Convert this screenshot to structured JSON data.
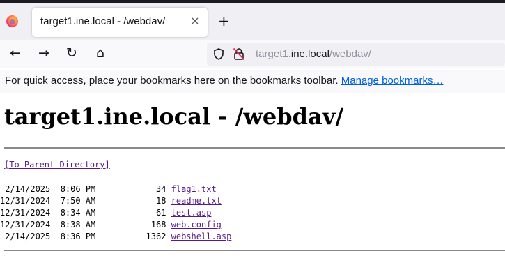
{
  "browser": {
    "tab": {
      "title": "target1.ine.local - /webdav/",
      "close": "×"
    },
    "new_tab": "+",
    "nav": {
      "back": "←",
      "forward": "→",
      "reload": "↻",
      "home": "⌂"
    },
    "url": {
      "prefix": "target1.",
      "domain": "ine.local",
      "path": "/webdav/"
    },
    "bookmarks": {
      "message": "For quick access, place your bookmarks here on the bookmarks toolbar. ",
      "manage_link": "Manage bookmarks…"
    }
  },
  "page": {
    "heading": "target1.ine.local - /webdav/",
    "parent_link": "[To Parent Directory]",
    "files": [
      {
        "date": " 2/14/2025",
        "time": " 8:06 PM",
        "size": "34",
        "name": "flag1.txt"
      },
      {
        "date": "12/31/2024",
        "time": " 7:50 AM",
        "size": "18",
        "name": "readme.txt"
      },
      {
        "date": "12/31/2024",
        "time": " 8:34 AM",
        "size": "61",
        "name": "test.asp"
      },
      {
        "date": "12/31/2024",
        "time": " 8:38 AM",
        "size": "168",
        "name": "web.config"
      },
      {
        "date": " 2/14/2025",
        "time": " 8:36 PM",
        "size": "1362",
        "name": "webshell.asp"
      }
    ]
  },
  "icons": {
    "firefox": "firefox-logo-icon",
    "shield": "tracking-shield-icon",
    "lock": "insecure-lock-icon"
  }
}
